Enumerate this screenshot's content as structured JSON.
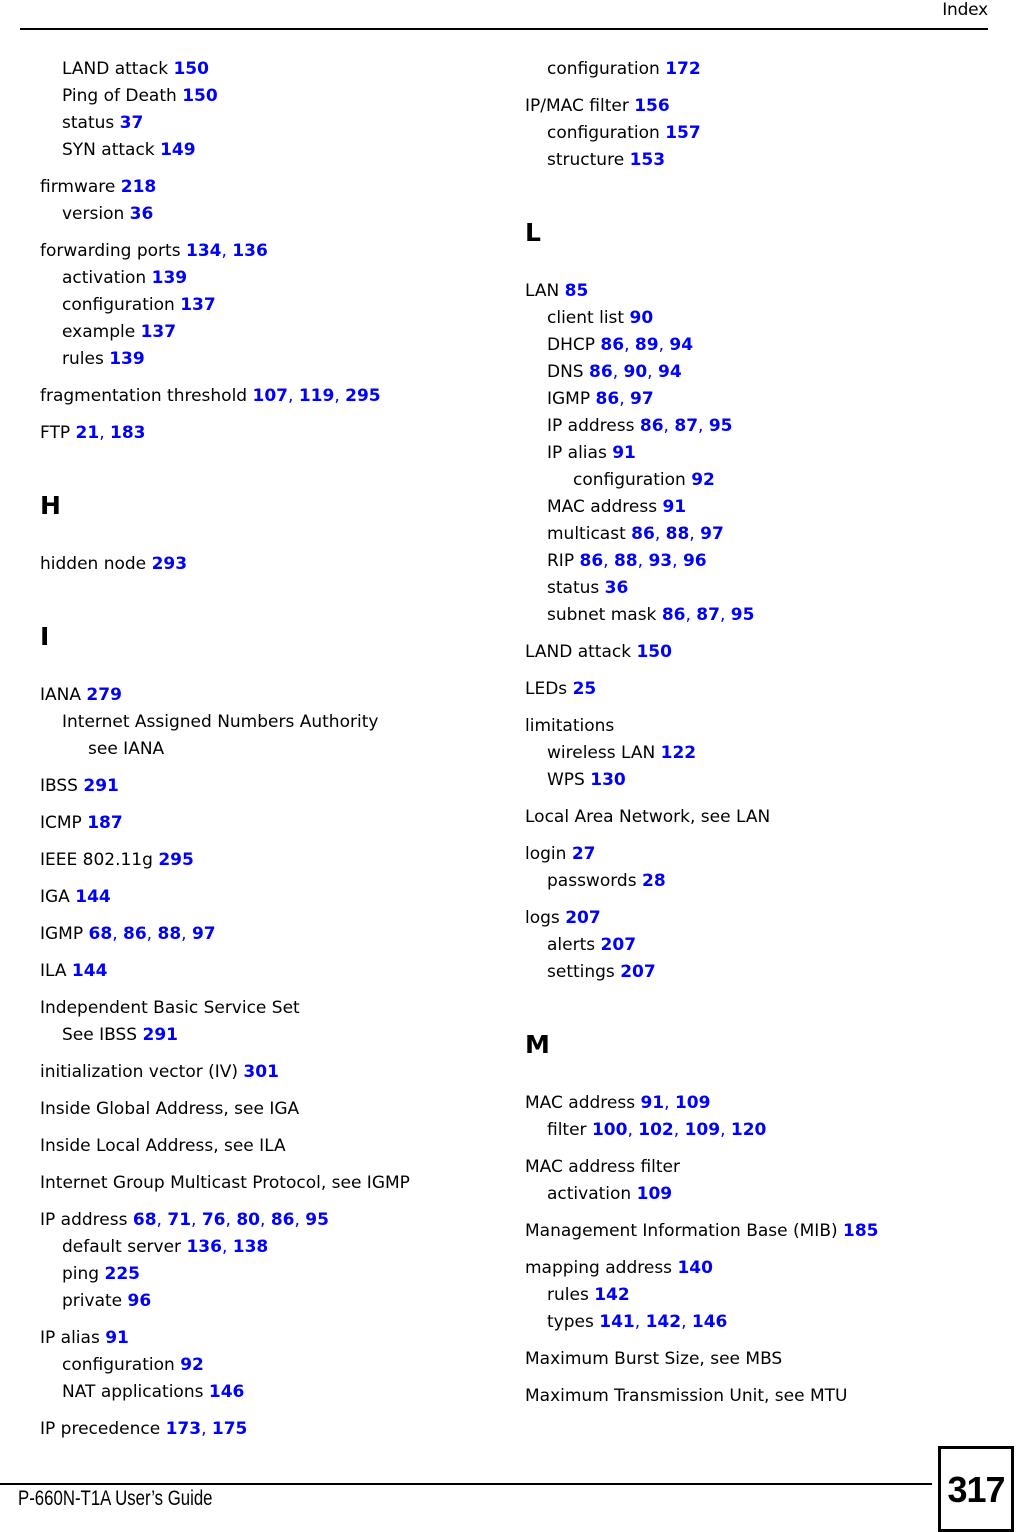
{
  "header": {
    "title": "Index"
  },
  "footer": {
    "guide_title": "P-660N-T1A User’s Guide",
    "page_number": "317"
  },
  "colors": {
    "page_reference": "#0000FF",
    "text": "#000000",
    "background": "#FFFFFF"
  },
  "left_column": [
    {
      "type": "group",
      "entries": [
        {
          "level": 1,
          "text": "LAND attack",
          "pages": [
            "150"
          ]
        },
        {
          "level": 1,
          "text": "Ping of Death",
          "pages": [
            "150"
          ]
        },
        {
          "level": 1,
          "text": "status",
          "pages": [
            "37"
          ]
        },
        {
          "level": 1,
          "text": "SYN attack",
          "pages": [
            "149"
          ]
        }
      ]
    },
    {
      "type": "group",
      "entries": [
        {
          "level": 0,
          "text": "firmware",
          "pages": [
            "218"
          ]
        },
        {
          "level": 1,
          "text": "version",
          "pages": [
            "36"
          ]
        }
      ]
    },
    {
      "type": "group",
      "entries": [
        {
          "level": 0,
          "text": "forwarding ports",
          "pages": [
            "134",
            "136"
          ]
        },
        {
          "level": 1,
          "text": "activation",
          "pages": [
            "139"
          ]
        },
        {
          "level": 1,
          "text": "configuration",
          "pages": [
            "137"
          ]
        },
        {
          "level": 1,
          "text": "example",
          "pages": [
            "137"
          ]
        },
        {
          "level": 1,
          "text": "rules",
          "pages": [
            "139"
          ]
        }
      ]
    },
    {
      "type": "group",
      "entries": [
        {
          "level": 0,
          "text": "fragmentation threshold",
          "pages": [
            "107",
            "119",
            "295"
          ]
        }
      ]
    },
    {
      "type": "group",
      "entries": [
        {
          "level": 0,
          "text": "FTP",
          "pages": [
            "21",
            "183"
          ]
        }
      ]
    },
    {
      "type": "letter",
      "letter": "H"
    },
    {
      "type": "group",
      "entries": [
        {
          "level": 0,
          "text": "hidden node",
          "pages": [
            "293"
          ]
        }
      ]
    },
    {
      "type": "letter",
      "letter": "I"
    },
    {
      "type": "group",
      "entries": [
        {
          "level": 0,
          "text": "IANA",
          "pages": [
            "279"
          ]
        },
        {
          "level": 1,
          "text": "Internet Assigned Numbers Authority",
          "pages": []
        },
        {
          "level": 2,
          "text": "see IANA",
          "pages": []
        }
      ]
    },
    {
      "type": "group",
      "entries": [
        {
          "level": 0,
          "text": "IBSS",
          "pages": [
            "291"
          ]
        }
      ]
    },
    {
      "type": "group",
      "entries": [
        {
          "level": 0,
          "text": "ICMP",
          "pages": [
            "187"
          ]
        }
      ]
    },
    {
      "type": "group",
      "entries": [
        {
          "level": 0,
          "text": "IEEE 802.11g",
          "pages": [
            "295"
          ]
        }
      ]
    },
    {
      "type": "group",
      "entries": [
        {
          "level": 0,
          "text": "IGA",
          "pages": [
            "144"
          ]
        }
      ]
    },
    {
      "type": "group",
      "entries": [
        {
          "level": 0,
          "text": "IGMP",
          "pages": [
            "68",
            "86",
            "88",
            "97"
          ]
        }
      ]
    },
    {
      "type": "group",
      "entries": [
        {
          "level": 0,
          "text": "ILA",
          "pages": [
            "144"
          ]
        }
      ]
    },
    {
      "type": "group",
      "entries": [
        {
          "level": 0,
          "text": "Independent Basic Service Set",
          "pages": []
        },
        {
          "level": 1,
          "text": "See IBSS",
          "pages": [
            "291"
          ]
        }
      ]
    },
    {
      "type": "group",
      "entries": [
        {
          "level": 0,
          "text": "initialization vector (IV)",
          "pages": [
            "301"
          ]
        }
      ]
    },
    {
      "type": "group",
      "entries": [
        {
          "level": 0,
          "text": "Inside Global Address, see IGA",
          "pages": []
        }
      ]
    },
    {
      "type": "group",
      "entries": [
        {
          "level": 0,
          "text": "Inside Local Address, see ILA",
          "pages": []
        }
      ]
    },
    {
      "type": "group",
      "entries": [
        {
          "level": 0,
          "text": "Internet Group Multicast Protocol, see IGMP",
          "pages": []
        }
      ]
    },
    {
      "type": "group",
      "entries": [
        {
          "level": 0,
          "text": "IP address",
          "pages": [
            "68",
            "71",
            "76",
            "80",
            "86",
            "95"
          ]
        },
        {
          "level": 1,
          "text": "default server",
          "pages": [
            "136",
            "138"
          ]
        },
        {
          "level": 1,
          "text": "ping",
          "pages": [
            "225"
          ]
        },
        {
          "level": 1,
          "text": "private",
          "pages": [
            "96"
          ]
        }
      ]
    },
    {
      "type": "group",
      "entries": [
        {
          "level": 0,
          "text": "IP alias",
          "pages": [
            "91"
          ]
        },
        {
          "level": 1,
          "text": "configuration",
          "pages": [
            "92"
          ]
        },
        {
          "level": 1,
          "text": "NAT applications",
          "pages": [
            "146"
          ]
        }
      ]
    },
    {
      "type": "group",
      "entries": [
        {
          "level": 0,
          "text": "IP precedence",
          "pages": [
            "173",
            "175"
          ]
        }
      ]
    }
  ],
  "right_column": [
    {
      "type": "group",
      "entries": [
        {
          "level": 1,
          "text": "configuration",
          "pages": [
            "172"
          ]
        }
      ]
    },
    {
      "type": "group",
      "entries": [
        {
          "level": 0,
          "text": "IP/MAC filter",
          "pages": [
            "156"
          ]
        },
        {
          "level": 1,
          "text": "configuration",
          "pages": [
            "157"
          ]
        },
        {
          "level": 1,
          "text": "structure",
          "pages": [
            "153"
          ]
        }
      ]
    },
    {
      "type": "letter",
      "letter": "L"
    },
    {
      "type": "group",
      "entries": [
        {
          "level": 0,
          "text": "LAN",
          "pages": [
            "85"
          ]
        },
        {
          "level": 1,
          "text": "client list",
          "pages": [
            "90"
          ]
        },
        {
          "level": 1,
          "text": "DHCP",
          "pages": [
            "86",
            "89",
            "94"
          ]
        },
        {
          "level": 1,
          "text": "DNS",
          "pages": [
            "86",
            "90",
            "94"
          ]
        },
        {
          "level": 1,
          "text": "IGMP",
          "pages": [
            "86",
            "97"
          ]
        },
        {
          "level": 1,
          "text": "IP address",
          "pages": [
            "86",
            "87",
            "95"
          ]
        },
        {
          "level": 1,
          "text": "IP alias",
          "pages": [
            "91"
          ]
        },
        {
          "level": 2,
          "text": "configuration",
          "pages": [
            "92"
          ]
        },
        {
          "level": 1,
          "text": "MAC address",
          "pages": [
            "91"
          ]
        },
        {
          "level": 1,
          "text": "multicast",
          "pages": [
            "86",
            "88",
            "97"
          ]
        },
        {
          "level": 1,
          "text": "RIP",
          "pages": [
            "86",
            "88",
            "93",
            "96"
          ]
        },
        {
          "level": 1,
          "text": "status",
          "pages": [
            "36"
          ]
        },
        {
          "level": 1,
          "text": "subnet mask",
          "pages": [
            "86",
            "87",
            "95"
          ]
        }
      ]
    },
    {
      "type": "group",
      "entries": [
        {
          "level": 0,
          "text": "LAND attack",
          "pages": [
            "150"
          ]
        }
      ]
    },
    {
      "type": "group",
      "entries": [
        {
          "level": 0,
          "text": "LEDs",
          "pages": [
            "25"
          ]
        }
      ]
    },
    {
      "type": "group",
      "entries": [
        {
          "level": 0,
          "text": "limitations",
          "pages": []
        },
        {
          "level": 1,
          "text": "wireless LAN",
          "pages": [
            "122"
          ]
        },
        {
          "level": 1,
          "text": "WPS",
          "pages": [
            "130"
          ]
        }
      ]
    },
    {
      "type": "group",
      "entries": [
        {
          "level": 0,
          "text": "Local Area Network, see LAN",
          "pages": []
        }
      ]
    },
    {
      "type": "group",
      "entries": [
        {
          "level": 0,
          "text": "login",
          "pages": [
            "27"
          ]
        },
        {
          "level": 1,
          "text": "passwords",
          "pages": [
            "28"
          ]
        }
      ]
    },
    {
      "type": "group",
      "entries": [
        {
          "level": 0,
          "text": "logs",
          "pages": [
            "207"
          ]
        },
        {
          "level": 1,
          "text": "alerts",
          "pages": [
            "207"
          ]
        },
        {
          "level": 1,
          "text": "settings",
          "pages": [
            "207"
          ]
        }
      ]
    },
    {
      "type": "letter",
      "letter": "M"
    },
    {
      "type": "group",
      "entries": [
        {
          "level": 0,
          "text": "MAC address",
          "pages": [
            "91",
            "109"
          ]
        },
        {
          "level": 1,
          "text": "filter",
          "pages": [
            "100",
            "102",
            "109",
            "120"
          ]
        }
      ]
    },
    {
      "type": "group",
      "entries": [
        {
          "level": 0,
          "text": "MAC address filter",
          "pages": []
        },
        {
          "level": 1,
          "text": "activation",
          "pages": [
            "109"
          ]
        }
      ]
    },
    {
      "type": "group",
      "entries": [
        {
          "level": 0,
          "text": "Management Information Base (MIB)",
          "pages": [
            "185"
          ]
        }
      ]
    },
    {
      "type": "group",
      "entries": [
        {
          "level": 0,
          "text": "mapping address",
          "pages": [
            "140"
          ]
        },
        {
          "level": 1,
          "text": "rules",
          "pages": [
            "142"
          ]
        },
        {
          "level": 1,
          "text": "types",
          "pages": [
            "141",
            "142",
            "146"
          ]
        }
      ]
    },
    {
      "type": "group",
      "entries": [
        {
          "level": 0,
          "text": "Maximum Burst Size, see MBS",
          "pages": []
        }
      ]
    },
    {
      "type": "group",
      "entries": [
        {
          "level": 0,
          "text": "Maximum Transmission Unit, see MTU",
          "pages": []
        }
      ]
    }
  ]
}
